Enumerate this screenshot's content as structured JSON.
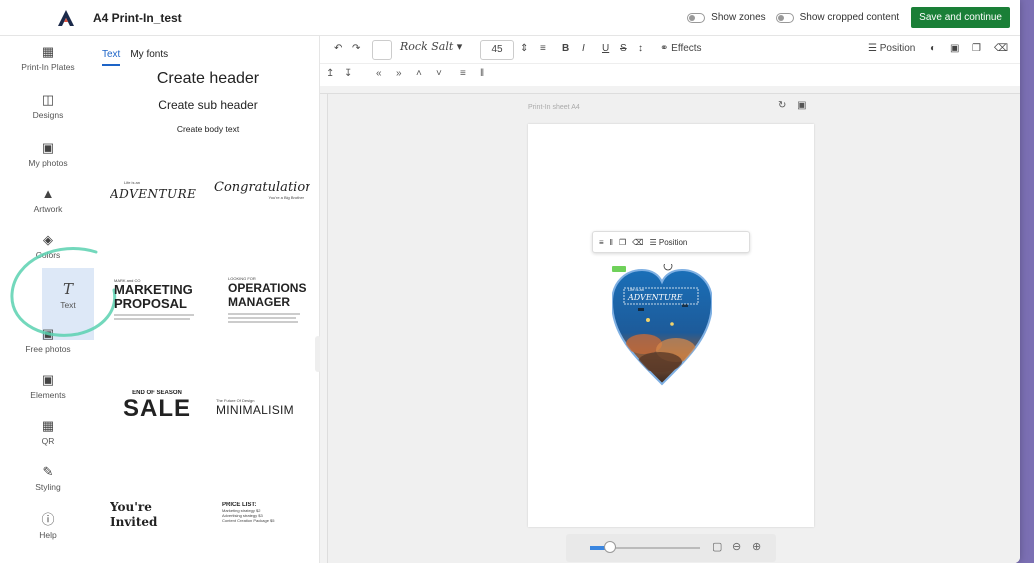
{
  "header": {
    "title": "A4 Print-In_test",
    "show_zones": "Show zones",
    "show_cropped": "Show cropped content",
    "save_label": "Save and continue",
    "accent": "#1a7f37"
  },
  "rail": {
    "items": [
      {
        "label": "Print-In Plates",
        "icon": "plates-icon"
      },
      {
        "label": "Designs",
        "icon": "designs-icon"
      },
      {
        "label": "My photos",
        "icon": "photos-icon"
      },
      {
        "label": "Artwork",
        "icon": "artwork-icon"
      },
      {
        "label": "Colors",
        "icon": "colors-icon"
      },
      {
        "label": "Text",
        "icon": "text-icon"
      },
      {
        "label": "Free photos",
        "icon": "free-photos-icon"
      },
      {
        "label": "Elements",
        "icon": "elements-icon"
      },
      {
        "label": "QR",
        "icon": "qr-icon"
      },
      {
        "label": "Styling",
        "icon": "styling-icon"
      },
      {
        "label": "Help",
        "icon": "help-icon"
      }
    ]
  },
  "panel": {
    "tabs": [
      "Text",
      "My fonts"
    ],
    "create_header": "Create header",
    "create_sub_header": "Create sub header",
    "create_body": "Create body text",
    "templates": {
      "adventure_small": "Life is an",
      "adventure_big": "ADVENTURE",
      "congrats": "Congratulations!",
      "congrats_sub": "You're a Big Brother",
      "mkt_small": "MARK and CO",
      "mkt_big1": "MARKETING",
      "mkt_big2": "PROPOSAL",
      "ops_small": "LOOKING FOR",
      "ops_big1": "OPERATIONS",
      "ops_big2": "MANAGER",
      "sale_small": "END OF SEASON",
      "sale_big": "SALE",
      "mini_small": "The Future Of Design",
      "mini_big": "MINIMALISIM",
      "invited1": "You're",
      "invited2": "Invited",
      "price_title": "PRICE LIST:",
      "price_rows": [
        "Marketing strategy  $2",
        "Advertising strategy  $3",
        "Content Creation Package  $5"
      ]
    }
  },
  "toolbar": {
    "font": "Rock Salt",
    "size": "45",
    "effects": "Effects",
    "position": "Position"
  },
  "canvas": {
    "sheet_label": "Print-In sheet A4",
    "float_position": "Position",
    "heart_text_small": "Life is an",
    "heart_text_big": "ADVENTURE"
  }
}
